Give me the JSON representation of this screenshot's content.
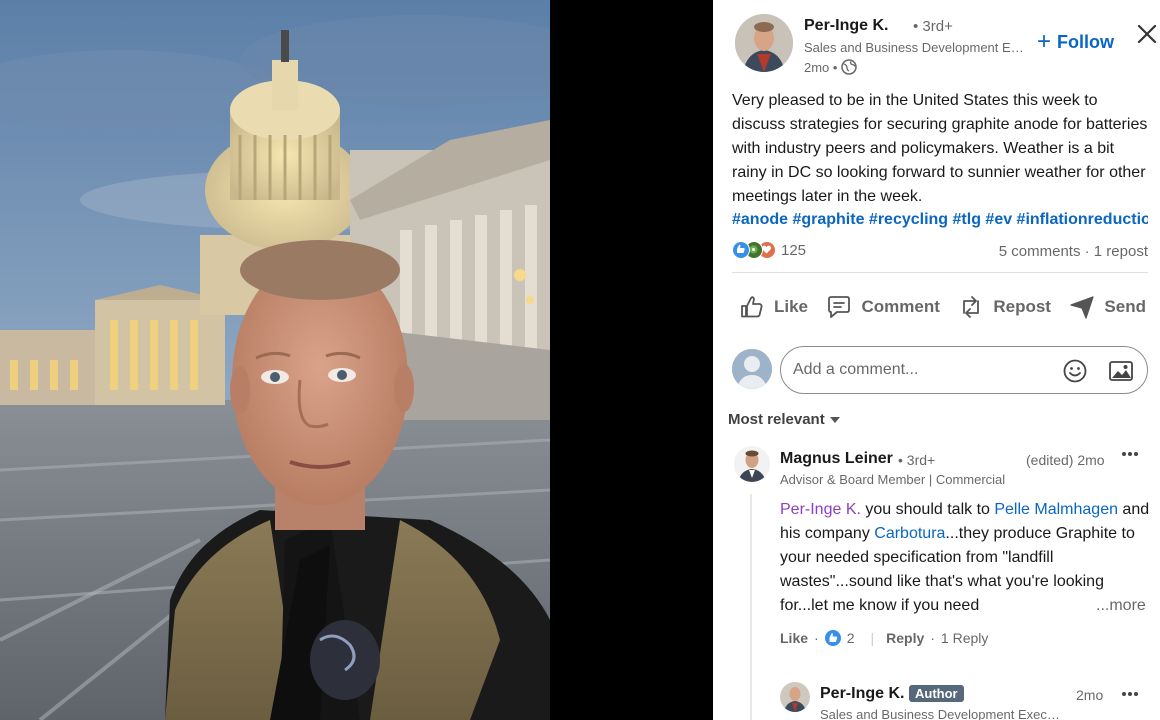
{
  "post": {
    "author": {
      "name": "Per-Inge K.",
      "degree": "• 3rd+",
      "headline": "Sales and Business Development Executive",
      "time": "2mo •"
    },
    "follow_label": "Follow",
    "text": "Very pleased to be in the United States this week to discuss strategies for securing graphite anode for batteries with industry peers and policymakers. Weather is a bit rainy in DC so looking forward to sunnier weather for other meetings later in the week.",
    "hashtags": "#anode #graphite #recycling #tlg #ev #inflationreduction",
    "reaction_count": "125",
    "comments_reposts": "5 comments · 1 repost"
  },
  "actions": {
    "like": "Like",
    "comment": "Comment",
    "repost": "Repost",
    "send": "Send"
  },
  "comment_box": {
    "placeholder": "Add a comment..."
  },
  "sort_label": "Most relevant",
  "comments": [
    {
      "name": "Magnus Leiner",
      "degree": "• 3rd+",
      "time": "(edited) 2mo",
      "headline": "Advisor & Board Member | Commercial",
      "mention_1": "Per-Inge K.",
      "text_1": " you should talk to ",
      "mention_2": "Pelle Malmhagen",
      "text_2": " and his company ",
      "mention_3": "Carbotura",
      "text_3": "...they produce Graphite to your needed specification from \"landfill wastes\"...sound like that's what you're looking for...let me know if you need",
      "see_more": "...more",
      "like_label": "Like",
      "like_count": "2",
      "reply_label": "Reply",
      "reply_count": "1 Reply"
    }
  ],
  "reply": {
    "name": "Per-Inge K.",
    "badge": "Author",
    "time": "2mo",
    "headline": "Sales and Business Development Executive"
  },
  "colors": {
    "brand": "#0a66c2",
    "author_badge": "#56687a"
  }
}
